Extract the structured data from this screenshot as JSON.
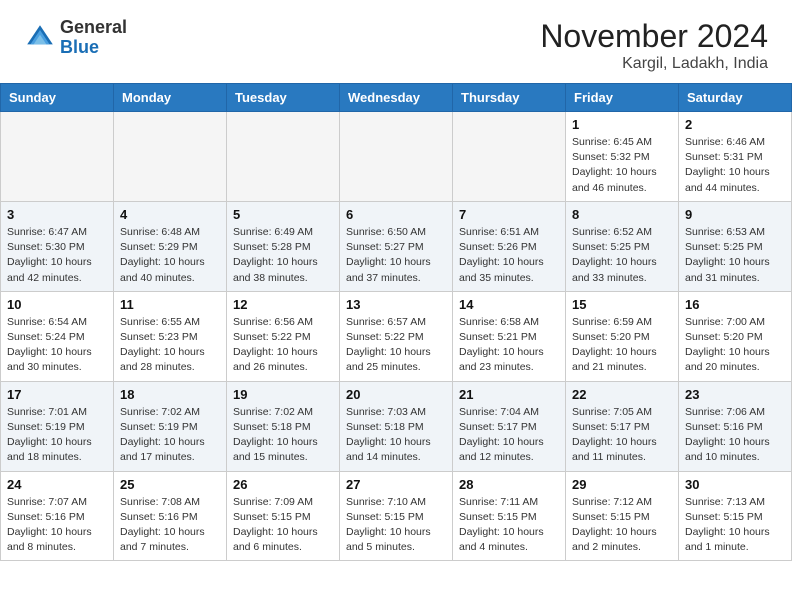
{
  "header": {
    "logo": {
      "line1": "General",
      "line2": "Blue"
    },
    "title": "November 2024",
    "location": "Kargil, Ladakh, India"
  },
  "weekdays": [
    "Sunday",
    "Monday",
    "Tuesday",
    "Wednesday",
    "Thursday",
    "Friday",
    "Saturday"
  ],
  "weeks": [
    [
      {
        "day": "",
        "info": ""
      },
      {
        "day": "",
        "info": ""
      },
      {
        "day": "",
        "info": ""
      },
      {
        "day": "",
        "info": ""
      },
      {
        "day": "",
        "info": ""
      },
      {
        "day": "1",
        "info": "Sunrise: 6:45 AM\nSunset: 5:32 PM\nDaylight: 10 hours\nand 46 minutes."
      },
      {
        "day": "2",
        "info": "Sunrise: 6:46 AM\nSunset: 5:31 PM\nDaylight: 10 hours\nand 44 minutes."
      }
    ],
    [
      {
        "day": "3",
        "info": "Sunrise: 6:47 AM\nSunset: 5:30 PM\nDaylight: 10 hours\nand 42 minutes."
      },
      {
        "day": "4",
        "info": "Sunrise: 6:48 AM\nSunset: 5:29 PM\nDaylight: 10 hours\nand 40 minutes."
      },
      {
        "day": "5",
        "info": "Sunrise: 6:49 AM\nSunset: 5:28 PM\nDaylight: 10 hours\nand 38 minutes."
      },
      {
        "day": "6",
        "info": "Sunrise: 6:50 AM\nSunset: 5:27 PM\nDaylight: 10 hours\nand 37 minutes."
      },
      {
        "day": "7",
        "info": "Sunrise: 6:51 AM\nSunset: 5:26 PM\nDaylight: 10 hours\nand 35 minutes."
      },
      {
        "day": "8",
        "info": "Sunrise: 6:52 AM\nSunset: 5:25 PM\nDaylight: 10 hours\nand 33 minutes."
      },
      {
        "day": "9",
        "info": "Sunrise: 6:53 AM\nSunset: 5:25 PM\nDaylight: 10 hours\nand 31 minutes."
      }
    ],
    [
      {
        "day": "10",
        "info": "Sunrise: 6:54 AM\nSunset: 5:24 PM\nDaylight: 10 hours\nand 30 minutes."
      },
      {
        "day": "11",
        "info": "Sunrise: 6:55 AM\nSunset: 5:23 PM\nDaylight: 10 hours\nand 28 minutes."
      },
      {
        "day": "12",
        "info": "Sunrise: 6:56 AM\nSunset: 5:22 PM\nDaylight: 10 hours\nand 26 minutes."
      },
      {
        "day": "13",
        "info": "Sunrise: 6:57 AM\nSunset: 5:22 PM\nDaylight: 10 hours\nand 25 minutes."
      },
      {
        "day": "14",
        "info": "Sunrise: 6:58 AM\nSunset: 5:21 PM\nDaylight: 10 hours\nand 23 minutes."
      },
      {
        "day": "15",
        "info": "Sunrise: 6:59 AM\nSunset: 5:20 PM\nDaylight: 10 hours\nand 21 minutes."
      },
      {
        "day": "16",
        "info": "Sunrise: 7:00 AM\nSunset: 5:20 PM\nDaylight: 10 hours\nand 20 minutes."
      }
    ],
    [
      {
        "day": "17",
        "info": "Sunrise: 7:01 AM\nSunset: 5:19 PM\nDaylight: 10 hours\nand 18 minutes."
      },
      {
        "day": "18",
        "info": "Sunrise: 7:02 AM\nSunset: 5:19 PM\nDaylight: 10 hours\nand 17 minutes."
      },
      {
        "day": "19",
        "info": "Sunrise: 7:02 AM\nSunset: 5:18 PM\nDaylight: 10 hours\nand 15 minutes."
      },
      {
        "day": "20",
        "info": "Sunrise: 7:03 AM\nSunset: 5:18 PM\nDaylight: 10 hours\nand 14 minutes."
      },
      {
        "day": "21",
        "info": "Sunrise: 7:04 AM\nSunset: 5:17 PM\nDaylight: 10 hours\nand 12 minutes."
      },
      {
        "day": "22",
        "info": "Sunrise: 7:05 AM\nSunset: 5:17 PM\nDaylight: 10 hours\nand 11 minutes."
      },
      {
        "day": "23",
        "info": "Sunrise: 7:06 AM\nSunset: 5:16 PM\nDaylight: 10 hours\nand 10 minutes."
      }
    ],
    [
      {
        "day": "24",
        "info": "Sunrise: 7:07 AM\nSunset: 5:16 PM\nDaylight: 10 hours\nand 8 minutes."
      },
      {
        "day": "25",
        "info": "Sunrise: 7:08 AM\nSunset: 5:16 PM\nDaylight: 10 hours\nand 7 minutes."
      },
      {
        "day": "26",
        "info": "Sunrise: 7:09 AM\nSunset: 5:15 PM\nDaylight: 10 hours\nand 6 minutes."
      },
      {
        "day": "27",
        "info": "Sunrise: 7:10 AM\nSunset: 5:15 PM\nDaylight: 10 hours\nand 5 minutes."
      },
      {
        "day": "28",
        "info": "Sunrise: 7:11 AM\nSunset: 5:15 PM\nDaylight: 10 hours\nand 4 minutes."
      },
      {
        "day": "29",
        "info": "Sunrise: 7:12 AM\nSunset: 5:15 PM\nDaylight: 10 hours\nand 2 minutes."
      },
      {
        "day": "30",
        "info": "Sunrise: 7:13 AM\nSunset: 5:15 PM\nDaylight: 10 hours\nand 1 minute."
      }
    ]
  ]
}
